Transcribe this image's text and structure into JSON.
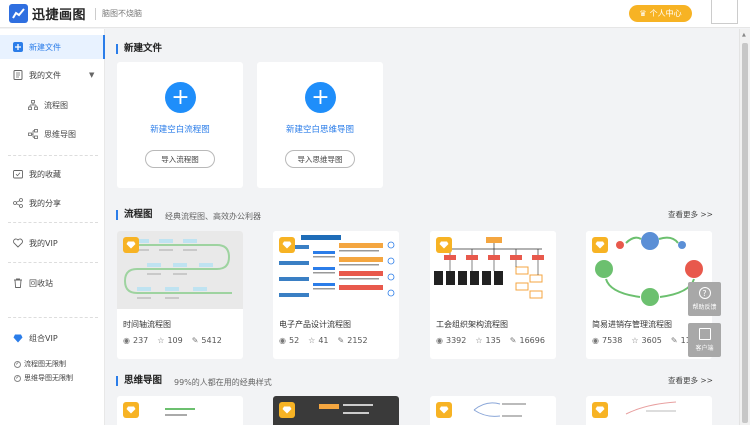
{
  "header": {
    "app_name": "迅捷画图",
    "slogan": "脑图不烧脑",
    "user_center": "个人中心"
  },
  "sidebar": {
    "new_file": "新建文件",
    "my_files": "我的文件",
    "flowchart": "流程图",
    "mindmap": "思维导图",
    "favorites": "我的收藏",
    "shares": "我的分享",
    "my_vip": "我的VIP",
    "recycle": "回收站",
    "combo_vip": "组合VIP",
    "vip_features": [
      "流程图无限制",
      "思维导图无限制"
    ]
  },
  "new_section": {
    "title": "新建文件",
    "cards": [
      {
        "label": "新建空白流程图",
        "import": "导入流程图"
      },
      {
        "label": "新建空白思维导图",
        "import": "导入思维导图"
      }
    ]
  },
  "flow_section": {
    "title": "流程图",
    "subtitle": "经典流程图、高效办公利器",
    "see_more": "查看更多 >>",
    "templates": [
      {
        "title": "时间轴流程图",
        "views": "237",
        "likes": "109",
        "edits": "5412"
      },
      {
        "title": "电子产品设计流程图",
        "views": "52",
        "likes": "41",
        "edits": "2152"
      },
      {
        "title": "工会组织架构流程图",
        "views": "3392",
        "likes": "135",
        "edits": "16696"
      },
      {
        "title": "简易进销存管理流程图",
        "views": "7538",
        "likes": "3605",
        "edits": "11"
      }
    ]
  },
  "mind_section": {
    "title": "思维导图",
    "subtitle": "99%的人都在用的经典样式",
    "see_more": "查看更多 >>"
  },
  "float": {
    "help": "帮助反馈",
    "service": "客户端"
  },
  "colors": {
    "accent": "#2b7de9",
    "plus": "#1f8efa",
    "vip_gold": "#f7b324",
    "float_gray": "#a8a8a8"
  }
}
